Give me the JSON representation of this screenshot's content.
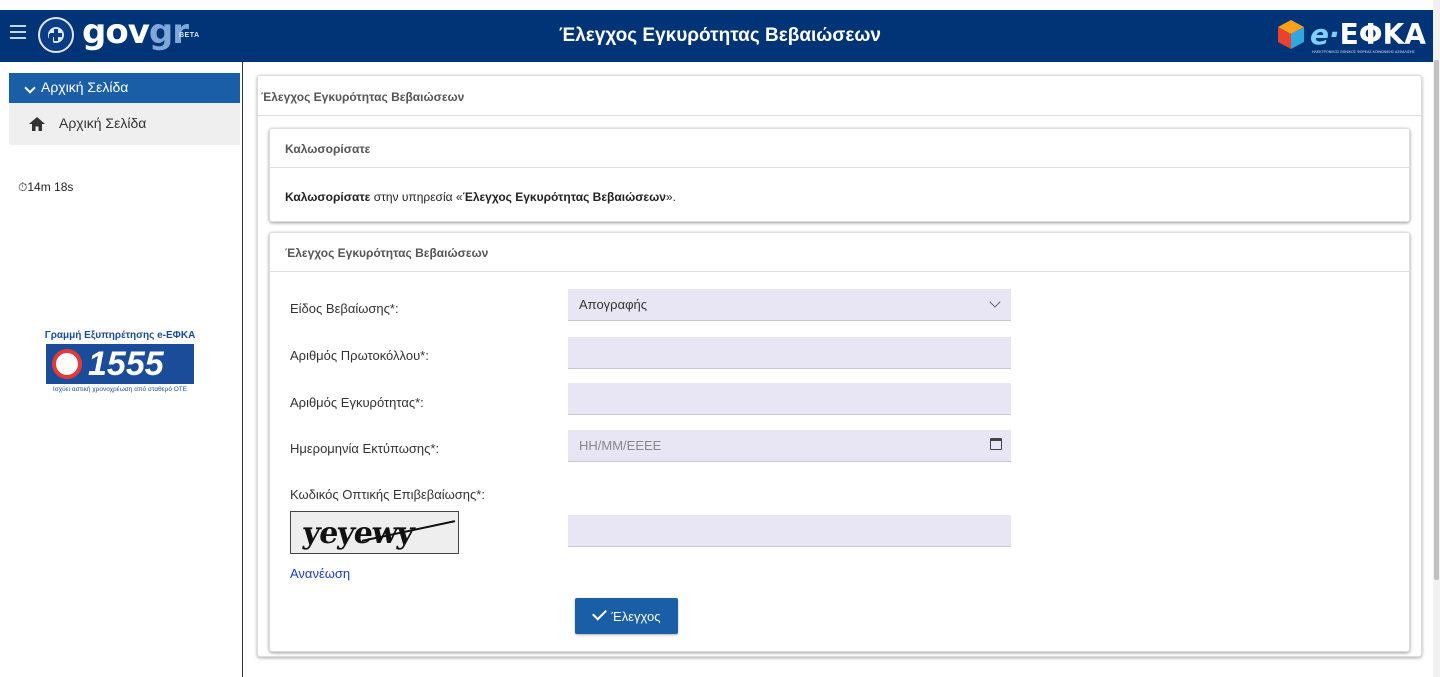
{
  "header": {
    "logo_main": "gov",
    "logo_suffix": "gr",
    "logo_badge": "BETA",
    "title": "Έλεγχος Εγκυρότητας Βεβαιώσεων",
    "partner_logo_prefix": "e·",
    "partner_logo_name": "ΕΦΚΑ",
    "partner_logo_subtitle": "ΗΛΕΚΤΡΟΝΙΚΟΣ ΕΘΝΙΚΟΣ ΦΟΡΕΑΣ ΚΟΙΝΩΝΙΚΗΣ ΑΣΦΑΛΙΣΗΣ"
  },
  "sidebar": {
    "section_label": "Αρχική Σελίδα",
    "items": [
      {
        "label": "Αρχική Σελίδα",
        "icon": "home-icon"
      }
    ],
    "timer": "14m 18s",
    "helpline": {
      "top": "Γραμμή Εξυπηρέτησης e-ΕΦΚΑ",
      "number": "1555",
      "bottom": "Ισχύει αστική χρονοχρέωση από σταθερό ΟΤΕ"
    }
  },
  "main": {
    "panel_title": "Έλεγχος Εγκυρότητας Βεβαιώσεων",
    "welcome": {
      "title": "Καλωσορίσατε",
      "text_bold": "Καλωσορίσατε",
      "text_mid": " στην υπηρεσία «",
      "text_service": "Έλεγχος Εγκυρότητας Βεβαιώσεων",
      "text_end": "»."
    },
    "form": {
      "title": "Έλεγχος Εγκυρότητας Βεβαιώσεων",
      "type_label": "Είδος Βεβαίωσης*:",
      "type_value": "Απογραφής",
      "protocol_label": "Αριθμός Πρωτοκόλλου*:",
      "protocol_value": "",
      "validity_label": "Αριθμός Εγκυρότητας*:",
      "validity_value": "",
      "date_label": "Ημερομηνία Εκτύπωσης*:",
      "date_placeholder": "ΗΗ/ΜΜ/ΕΕΕΕ",
      "captcha_label": "Κωδικός Οπτικής Επιβεβαίωσης*:",
      "captcha_image_text": "yeyewy",
      "captcha_value": "",
      "refresh_label": "Ανανέωση",
      "submit_label": "Έλεγχος"
    }
  }
}
